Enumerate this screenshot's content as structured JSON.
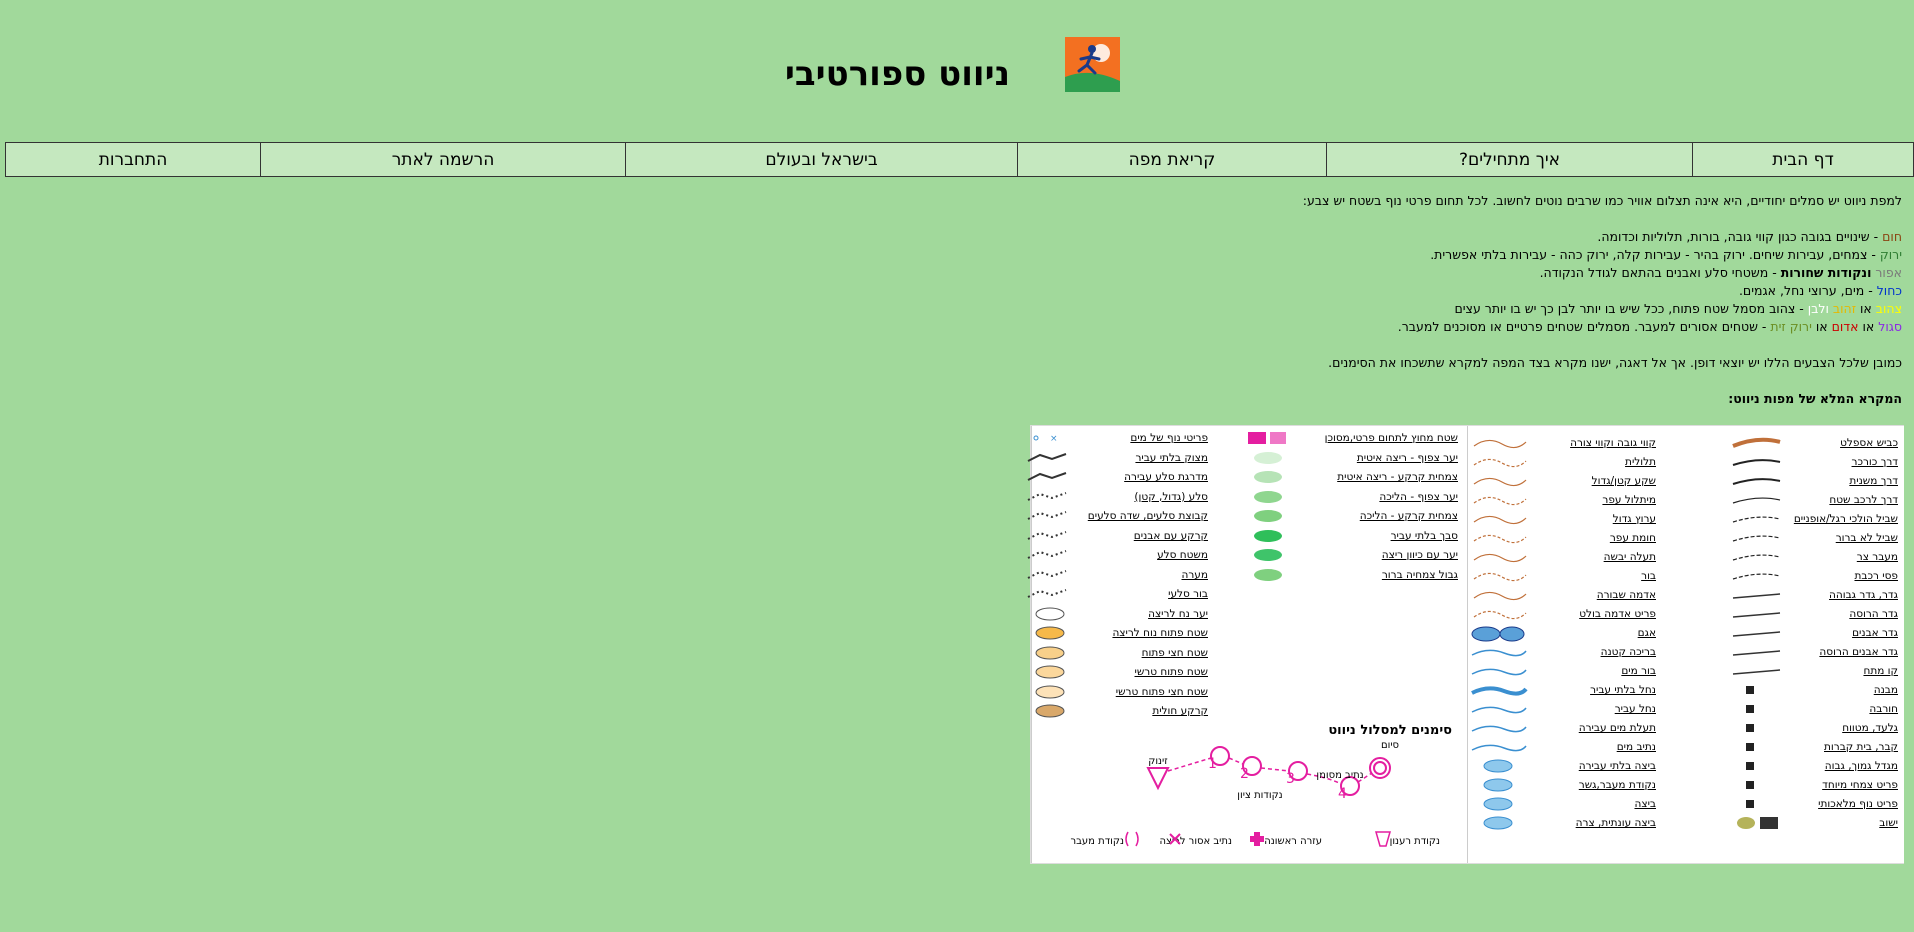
{
  "site": {
    "title": "ניווט ספורטיבי",
    "logo_icon": "orienteering-runner-logo"
  },
  "nav": {
    "items": [
      {
        "label": "דף הבית"
      },
      {
        "label": "איך מתחילים?"
      },
      {
        "label": "קריאת מפה"
      },
      {
        "label": "בישראל ובעולם"
      },
      {
        "label": "הרשמה לאתר"
      },
      {
        "label": "התחברות"
      }
    ]
  },
  "content": {
    "intro": "למפת ניווט יש סמלים יחודיים, היא אינה תצלום אוויר כמו שרבים נוטים לחשוב. לכל תחום פרטי נוף בשטח יש צבע:",
    "colors": [
      {
        "word": "חום",
        "color": "#8b4513",
        "text": " - שינויים בגובה כגון קווי גובה, בורות, תלוליות וכדומה."
      },
      {
        "word": "ירוק",
        "color": "#2e7d32",
        "text": " - צמחים, עבירות שיחים. ירוק בהיר - עבירות קלה, ירוק כהה - עבירות בלתי אפשרית."
      },
      {
        "word": "אפור",
        "color": "#7a7a7a",
        "mid_word": "ונקודות שחורות",
        "text": " - משטחי סלע ואבנים בהתאם לגודל הנקודה."
      },
      {
        "word": "כחול",
        "color": "#0033cc",
        "text": " - מים, ערוצי נחל, אגמים."
      },
      {
        "word": "צהוב",
        "color": "#ffff00",
        "or1": "או",
        "word2": "זהוב",
        "color2": "#e6b800",
        "and": "ולבן",
        "color3": "#ffffff",
        "text": " - צהוב מסמל שטח פתוח, ככל שיש בו יותר לבן כך יש בו יותר עצים"
      },
      {
        "word": "סגול",
        "color": "#8a2be2",
        "or1": "או",
        "word2": "אדום",
        "color2": "#cc0000",
        "or2": "או",
        "word3": "ירוק זית",
        "color3": "#6b8e23",
        "text": " - שטחים אסורים למעבר. מסמלים שטחים פרטיים או מסוכנים למעבר."
      }
    ],
    "note": "כמובן שלכל הצבעים הללו יש יוצאי דופן. אך אל דאגה, ישנו מקרא בצד המפה למקרא שתשכחו את הסימנים.",
    "legend_heading": "המקרא המלא של מפות ניווט:"
  },
  "legend": {
    "col1": [
      "כביש אספלט",
      "דרך כורכר",
      "דרך משנית",
      "דרך לרכב שטח",
      "שביל הולכי רגל/אופניים",
      "שביל לא ברור",
      "מעבר צר",
      "פסי רכבת",
      "גדר, גדר גבוהה",
      "גדר הרוסה",
      "גדר אבנים",
      "גדר אבנים הרוסה",
      "קו מתח",
      "מבנה",
      "חורבה",
      "גלעד, מטווח",
      "קבר, בית קברות",
      "מגדל גמוך, גבוה",
      "פריט צמחי מיוחד",
      "פריט נוף מלאכותי",
      "ישוב"
    ],
    "col2": [
      "קווי גובה וקווי צורה",
      "תלולית",
      "שקע קטן/גדול",
      "מיתלול עפר",
      "ערוץ גדול",
      "חומת עפר",
      "תעלה יבשה",
      "בור",
      "אדמה שבורה",
      "פריט אדמה בולט",
      "אגם",
      "בריכה קטנה",
      "בור מים",
      "נחל בלתי עביר",
      "נחל עביר",
      "תעלת מים עבירה",
      "נתיב מים",
      "ביצה בלתי עבירה",
      "נקודת מעבר,גשר",
      "ביצה",
      "ביצה עונתית, צרה"
    ],
    "col3": [
      "שטח מחוץ לתחום פרטי,מסוכן",
      "יער צפוף - ריצה איטית",
      "צמחית קרקע - ריצה איטית",
      "יער צפוף - הליכה",
      "צמחית קרקע - הליכה",
      "סבך בלתי עביר",
      "יער עם כיוון ריצה",
      "גבול צמחיה ברור"
    ],
    "col4": [
      "פריטי נוף של מים",
      "מצוק בלתי עביר",
      "מדרגת סלע עבירה",
      "סלע (גדול, קטן)",
      "קבוצת סלעים, שדה סלעים",
      "קרקע עם אבנים",
      "משטח סלע",
      "מערה",
      "בור סלעי",
      "יער נח לריצה",
      "שטח פתוח נוח לריצה",
      "שטח חצי פתוח",
      "שטח פתוח טרשי",
      "שטח חצי פתוח טרשי",
      "קרקע חולית"
    ],
    "route": {
      "heading": "סימנים למסלול ניווט",
      "start": "זינוק",
      "finish": "סיום",
      "controls": "נקודות ציון",
      "mandatory": "נתיב מסומן",
      "numbers": [
        "1",
        "2",
        "3",
        "4"
      ],
      "bottom": [
        "נקודת רענון",
        "עזרה ראשונה",
        "נתיב אסור לריצה",
        "נקודת מעבר"
      ]
    }
  }
}
